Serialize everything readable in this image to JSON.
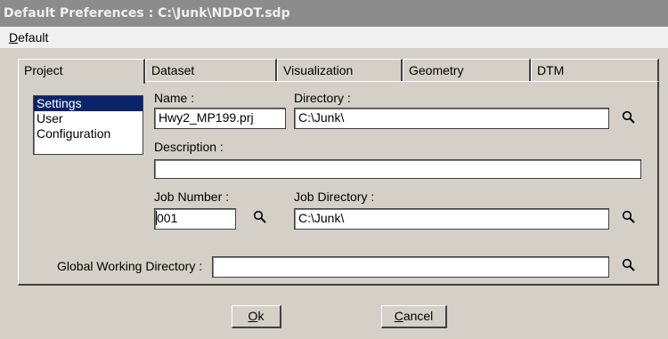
{
  "window": {
    "title": "Default Preferences : C:\\Junk\\NDDOT.sdp"
  },
  "menu": {
    "default_accel": "D",
    "default_rest": "efault"
  },
  "tabs": [
    {
      "label": "Project"
    },
    {
      "label": "Dataset"
    },
    {
      "label": "Visualization"
    },
    {
      "label": "Geometry"
    },
    {
      "label": "DTM"
    }
  ],
  "category_list": [
    "Settings",
    "User",
    "Configuration"
  ],
  "selected_category": "Settings",
  "fields": {
    "name_label": "Name :",
    "name_value": "Hwy2_MP199.prj",
    "directory_label": "Directory :",
    "directory_value": "C:\\Junk\\",
    "description_label": "Description :",
    "description_value": "",
    "job_number_label": "Job Number :",
    "job_number_value": "001",
    "job_directory_label": "Job Directory :",
    "job_directory_value": "C:\\Junk\\",
    "global_dir_label": "Global Working Directory :",
    "global_dir_value": ""
  },
  "buttons": {
    "ok_accel": "O",
    "ok_rest": "k",
    "cancel_accel": "C",
    "cancel_rest": "ancel"
  },
  "icons": {
    "browse": "magnifier-icon"
  },
  "colors": {
    "titlebar": "#8c8c8c",
    "selection": "#0a246a",
    "face": "#d4d0c8"
  }
}
